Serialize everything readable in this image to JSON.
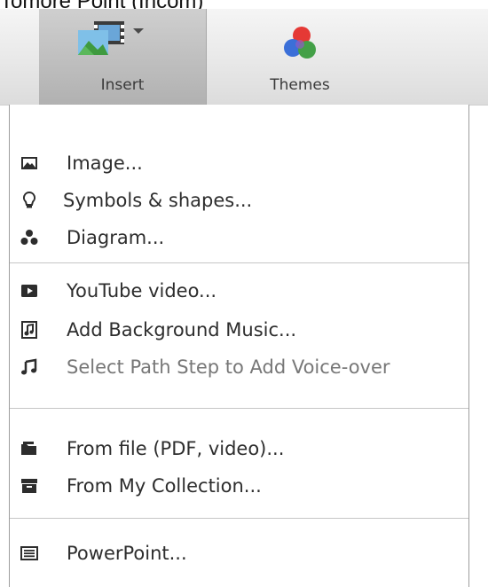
{
  "top_caption": "Tomore Point (Incom)",
  "toolbar": {
    "insert_label": "Insert",
    "themes_label": "Themes"
  },
  "menu": {
    "items": [
      {
        "label": "Image...",
        "icon": "image-icon"
      },
      {
        "label": "Symbols & shapes...",
        "icon": "lightbulb-icon"
      },
      {
        "label": "Diagram...",
        "icon": "diagram-icon"
      },
      {
        "label": "YouTube video...",
        "icon": "youtube-icon"
      },
      {
        "label": "Add Background Music...",
        "icon": "music-file-icon"
      },
      {
        "label": "Select Path Step to Add Voice-over",
        "icon": "music-note-icon",
        "disabled": true
      },
      {
        "label": "From file (PDF, video)...",
        "icon": "folder-icon"
      },
      {
        "label": "From My Collection...",
        "icon": "collection-icon"
      },
      {
        "label": "PowerPoint...",
        "icon": "powerpoint-icon"
      }
    ]
  },
  "colors": {
    "menu_text": "#2d2d2d",
    "disabled_text": "#777777",
    "toolbar_active": "#bdbdbd"
  }
}
